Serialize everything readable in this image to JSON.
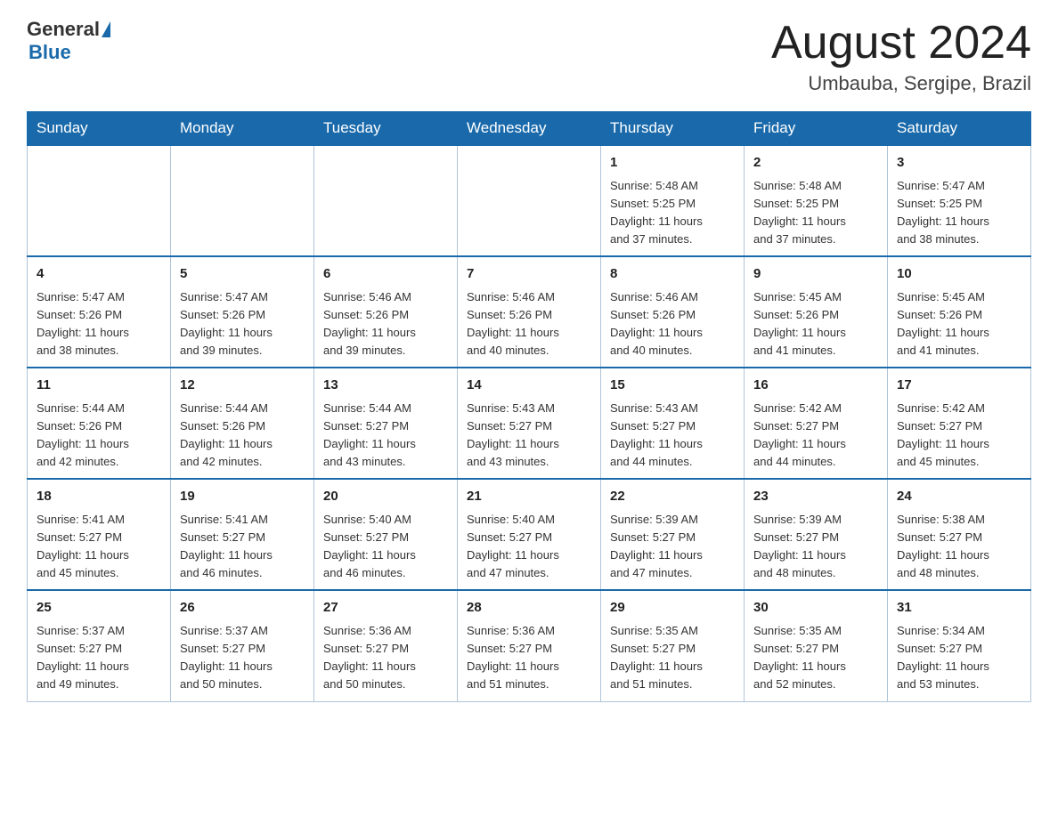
{
  "header": {
    "logo_general": "General",
    "logo_blue": "Blue",
    "month_title": "August 2024",
    "location": "Umbauba, Sergipe, Brazil"
  },
  "days_of_week": [
    "Sunday",
    "Monday",
    "Tuesday",
    "Wednesday",
    "Thursday",
    "Friday",
    "Saturday"
  ],
  "weeks": [
    [
      {
        "day": "",
        "info": ""
      },
      {
        "day": "",
        "info": ""
      },
      {
        "day": "",
        "info": ""
      },
      {
        "day": "",
        "info": ""
      },
      {
        "day": "1",
        "info": "Sunrise: 5:48 AM\nSunset: 5:25 PM\nDaylight: 11 hours\nand 37 minutes."
      },
      {
        "day": "2",
        "info": "Sunrise: 5:48 AM\nSunset: 5:25 PM\nDaylight: 11 hours\nand 37 minutes."
      },
      {
        "day": "3",
        "info": "Sunrise: 5:47 AM\nSunset: 5:25 PM\nDaylight: 11 hours\nand 38 minutes."
      }
    ],
    [
      {
        "day": "4",
        "info": "Sunrise: 5:47 AM\nSunset: 5:26 PM\nDaylight: 11 hours\nand 38 minutes."
      },
      {
        "day": "5",
        "info": "Sunrise: 5:47 AM\nSunset: 5:26 PM\nDaylight: 11 hours\nand 39 minutes."
      },
      {
        "day": "6",
        "info": "Sunrise: 5:46 AM\nSunset: 5:26 PM\nDaylight: 11 hours\nand 39 minutes."
      },
      {
        "day": "7",
        "info": "Sunrise: 5:46 AM\nSunset: 5:26 PM\nDaylight: 11 hours\nand 40 minutes."
      },
      {
        "day": "8",
        "info": "Sunrise: 5:46 AM\nSunset: 5:26 PM\nDaylight: 11 hours\nand 40 minutes."
      },
      {
        "day": "9",
        "info": "Sunrise: 5:45 AM\nSunset: 5:26 PM\nDaylight: 11 hours\nand 41 minutes."
      },
      {
        "day": "10",
        "info": "Sunrise: 5:45 AM\nSunset: 5:26 PM\nDaylight: 11 hours\nand 41 minutes."
      }
    ],
    [
      {
        "day": "11",
        "info": "Sunrise: 5:44 AM\nSunset: 5:26 PM\nDaylight: 11 hours\nand 42 minutes."
      },
      {
        "day": "12",
        "info": "Sunrise: 5:44 AM\nSunset: 5:26 PM\nDaylight: 11 hours\nand 42 minutes."
      },
      {
        "day": "13",
        "info": "Sunrise: 5:44 AM\nSunset: 5:27 PM\nDaylight: 11 hours\nand 43 minutes."
      },
      {
        "day": "14",
        "info": "Sunrise: 5:43 AM\nSunset: 5:27 PM\nDaylight: 11 hours\nand 43 minutes."
      },
      {
        "day": "15",
        "info": "Sunrise: 5:43 AM\nSunset: 5:27 PM\nDaylight: 11 hours\nand 44 minutes."
      },
      {
        "day": "16",
        "info": "Sunrise: 5:42 AM\nSunset: 5:27 PM\nDaylight: 11 hours\nand 44 minutes."
      },
      {
        "day": "17",
        "info": "Sunrise: 5:42 AM\nSunset: 5:27 PM\nDaylight: 11 hours\nand 45 minutes."
      }
    ],
    [
      {
        "day": "18",
        "info": "Sunrise: 5:41 AM\nSunset: 5:27 PM\nDaylight: 11 hours\nand 45 minutes."
      },
      {
        "day": "19",
        "info": "Sunrise: 5:41 AM\nSunset: 5:27 PM\nDaylight: 11 hours\nand 46 minutes."
      },
      {
        "day": "20",
        "info": "Sunrise: 5:40 AM\nSunset: 5:27 PM\nDaylight: 11 hours\nand 46 minutes."
      },
      {
        "day": "21",
        "info": "Sunrise: 5:40 AM\nSunset: 5:27 PM\nDaylight: 11 hours\nand 47 minutes."
      },
      {
        "day": "22",
        "info": "Sunrise: 5:39 AM\nSunset: 5:27 PM\nDaylight: 11 hours\nand 47 minutes."
      },
      {
        "day": "23",
        "info": "Sunrise: 5:39 AM\nSunset: 5:27 PM\nDaylight: 11 hours\nand 48 minutes."
      },
      {
        "day": "24",
        "info": "Sunrise: 5:38 AM\nSunset: 5:27 PM\nDaylight: 11 hours\nand 48 minutes."
      }
    ],
    [
      {
        "day": "25",
        "info": "Sunrise: 5:37 AM\nSunset: 5:27 PM\nDaylight: 11 hours\nand 49 minutes."
      },
      {
        "day": "26",
        "info": "Sunrise: 5:37 AM\nSunset: 5:27 PM\nDaylight: 11 hours\nand 50 minutes."
      },
      {
        "day": "27",
        "info": "Sunrise: 5:36 AM\nSunset: 5:27 PM\nDaylight: 11 hours\nand 50 minutes."
      },
      {
        "day": "28",
        "info": "Sunrise: 5:36 AM\nSunset: 5:27 PM\nDaylight: 11 hours\nand 51 minutes."
      },
      {
        "day": "29",
        "info": "Sunrise: 5:35 AM\nSunset: 5:27 PM\nDaylight: 11 hours\nand 51 minutes."
      },
      {
        "day": "30",
        "info": "Sunrise: 5:35 AM\nSunset: 5:27 PM\nDaylight: 11 hours\nand 52 minutes."
      },
      {
        "day": "31",
        "info": "Sunrise: 5:34 AM\nSunset: 5:27 PM\nDaylight: 11 hours\nand 53 minutes."
      }
    ]
  ]
}
